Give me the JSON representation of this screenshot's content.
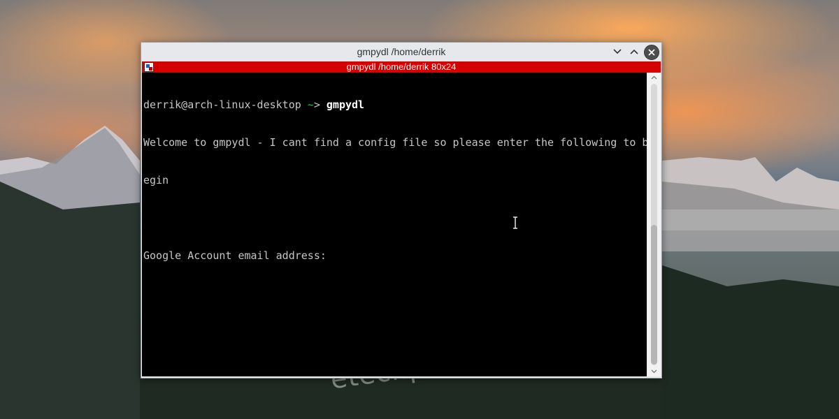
{
  "window": {
    "title": "gmpydl /home/derrik",
    "controls": {
      "minimize": "chevron-down-icon",
      "maximize": "chevron-up-icon",
      "close": "close-icon"
    }
  },
  "tab": {
    "label": "gmpydl  /home/derrik 80x24",
    "color": "#d50000"
  },
  "terminal": {
    "prompt_user": "derrik@arch-linux-desktop",
    "prompt_dir": "~",
    "prompt_symbol": ">",
    "command": "gmpydl",
    "output": [
      "Welcome to gmpydl - I cant find a config file so please enter the following to b",
      "egin",
      "",
      "Google Account email address:"
    ]
  },
  "watermark": "etechpt.com",
  "colors": {
    "terminal_bg": "#000000",
    "terminal_fg": "#c6c6c6",
    "prompt_tilde": "#3cb043",
    "tab_accent": "#d50000"
  }
}
